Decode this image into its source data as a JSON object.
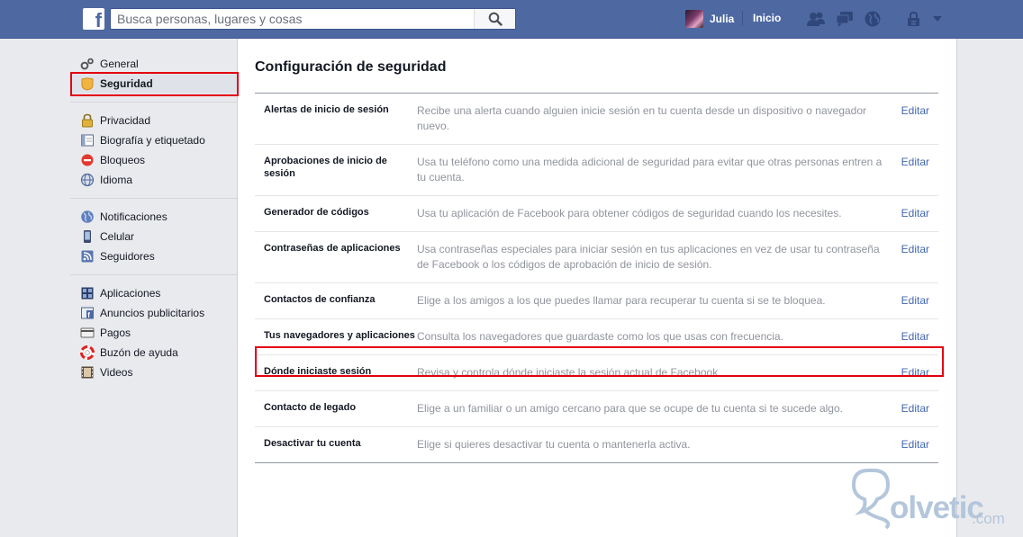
{
  "topbar": {
    "logo": "f",
    "search_placeholder": "Busca personas, lugares y cosas",
    "user_name": "Julia",
    "home_label": "Inicio"
  },
  "sidebar": {
    "groups": [
      [
        {
          "label": "General",
          "icon": "gears-icon"
        },
        {
          "label": "Seguridad",
          "icon": "shield-badge-icon",
          "active": true
        }
      ],
      [
        {
          "label": "Privacidad",
          "icon": "lock-icon"
        },
        {
          "label": "Biografía y etiquetado",
          "icon": "timeline-icon"
        },
        {
          "label": "Bloqueos",
          "icon": "block-icon"
        },
        {
          "label": "Idioma",
          "icon": "globe-icon"
        }
      ],
      [
        {
          "label": "Notificaciones",
          "icon": "earth-icon"
        },
        {
          "label": "Celular",
          "icon": "phone-icon"
        },
        {
          "label": "Seguidores",
          "icon": "rss-icon"
        }
      ],
      [
        {
          "label": "Aplicaciones",
          "icon": "apps-icon"
        },
        {
          "label": "Anuncios publicitarios",
          "icon": "ads-icon"
        },
        {
          "label": "Pagos",
          "icon": "credit-card-icon"
        },
        {
          "label": "Buzón de ayuda",
          "icon": "lifebuoy-icon"
        },
        {
          "label": "Videos",
          "icon": "film-icon"
        }
      ]
    ]
  },
  "main": {
    "title": "Configuración de seguridad",
    "edit_label": "Editar",
    "rows": [
      {
        "label": "Alertas de inicio de sesión",
        "desc": "Recibe una alerta cuando alguien inicie sesión en tu cuenta desde un dispositivo o navegador nuevo."
      },
      {
        "label": "Aprobaciones de inicio de sesión",
        "desc": "Usa tu teléfono como una medida adicional de seguridad para evitar que otras personas entren a tu cuenta."
      },
      {
        "label": "Generador de códigos",
        "desc": "Usa tu aplicación de Facebook para obtener códigos de seguridad cuando los necesites."
      },
      {
        "label": "Contraseñas de aplicaciones",
        "desc": "Usa contraseñas especiales para iniciar sesión en tus aplicaciones en vez de usar tu contraseña de Facebook o los códigos de aprobación de inicio de sesión."
      },
      {
        "label": "Contactos de confianza",
        "desc": "Elige a los amigos a los que puedes llamar para recuperar tu cuenta si se te bloquea."
      },
      {
        "label": "Tus navegadores y aplicaciones",
        "desc": "Consulta los navegadores que guardaste como los que usas con frecuencia."
      },
      {
        "label": "Dónde iniciaste sesión",
        "desc": "Revisa y controla dónde iniciaste la sesión actual de Facebook.",
        "highlighted": true
      },
      {
        "label": "Contacto de legado",
        "desc": "Elige a un familiar o un amigo cercano para que se ocupe de tu cuenta si te sucede algo."
      },
      {
        "label": "Desactivar tu cuenta",
        "desc": "Elige si quieres desactivar tu cuenta o mantenerla activa."
      }
    ]
  },
  "watermark": {
    "brand": "olvetic",
    "suffix": ".com"
  },
  "colors": {
    "topbar": "#4e69a2",
    "link": "#4267b2",
    "highlight": "#e3000f"
  }
}
